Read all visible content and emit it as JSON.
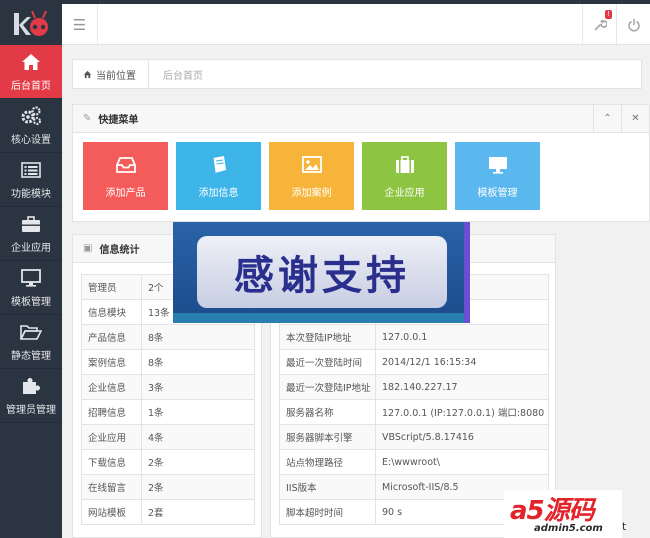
{
  "sidebar": {
    "logo_icon": "bug-logo",
    "items": [
      {
        "label": "后台首页",
        "icon": "home-icon",
        "active": true
      },
      {
        "label": "核心设置",
        "icon": "cogs-icon"
      },
      {
        "label": "功能模块",
        "icon": "list-icon"
      },
      {
        "label": "企业应用",
        "icon": "briefcase-icon"
      },
      {
        "label": "模板管理",
        "icon": "monitor-icon"
      },
      {
        "label": "静态管理",
        "icon": "folder-open-icon"
      },
      {
        "label": "管理员管理",
        "icon": "puzzle-icon"
      }
    ]
  },
  "topbar": {
    "menu_icon": "hamburger-icon",
    "wrench_badge": "!",
    "power_icon": "power-icon"
  },
  "breadcrumb": {
    "location_label": "当前位置",
    "current": "后台首页"
  },
  "quick_menu": {
    "title": "快捷菜单",
    "tiles": [
      {
        "label": "添加产品",
        "color": "#f45b5b"
      },
      {
        "label": "添加信息",
        "color": "#3db5e9"
      },
      {
        "label": "添加案例",
        "color": "#f6b53a"
      },
      {
        "label": "企业应用",
        "color": "#8dc441"
      },
      {
        "label": "模板管理",
        "color": "#5ab8ee"
      }
    ]
  },
  "stats": {
    "title": "信息统计",
    "rows": [
      {
        "k": "管理员",
        "v": "2个"
      },
      {
        "k": "信息模块",
        "v": "13条"
      },
      {
        "k": "产品信息",
        "v": "8条"
      },
      {
        "k": "案例信息",
        "v": "8条"
      },
      {
        "k": "企业信息",
        "v": "3条"
      },
      {
        "k": "招聘信息",
        "v": "1条"
      },
      {
        "k": "企业应用",
        "v": "4条"
      },
      {
        "k": "下载信息",
        "v": "2条"
      },
      {
        "k": "在线留言",
        "v": "2条"
      },
      {
        "k": "网站模板",
        "v": "2套"
      }
    ]
  },
  "sysinfo": {
    "rows": [
      {
        "k": "",
        "v": ""
      },
      {
        "k": "",
        "v": ""
      },
      {
        "k": "本次登陆IP地址",
        "v": "127.0.0.1"
      },
      {
        "k": "最近一次登陆时间",
        "v": "2014/12/1 16:15:34"
      },
      {
        "k": "最近一次登陆IP地址",
        "v": "182.140.227.17"
      },
      {
        "k": "服务器名称",
        "v": "127.0.0.1 (IP:127.0.0.1) 端口:8080"
      },
      {
        "k": "服务器脚本引擎",
        "v": "VBScript/5.8.17416"
      },
      {
        "k": "站点物理路径",
        "v": "E:\\wwwroot\\"
      },
      {
        "k": "IIS版本",
        "v": "Microsoft-IIS/8.5"
      },
      {
        "k": "脚本超时时间",
        "v": "90 s"
      }
    ]
  },
  "banner": {
    "text": "感谢支持"
  },
  "watermark": {
    "logo": "a5源码",
    "url": "admin5.com",
    "trail": "t"
  }
}
